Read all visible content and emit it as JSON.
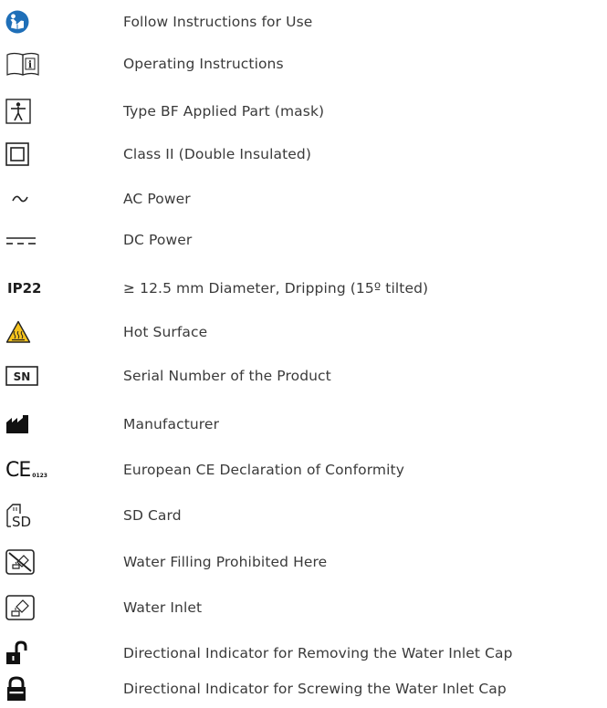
{
  "symbols": [
    {
      "icon": "follow-instructions-icon",
      "description": "Follow Instructions for Use"
    },
    {
      "icon": "operating-instructions-icon",
      "description": "Operating Instructions"
    },
    {
      "icon": "type-bf-applied-part-icon",
      "description": "Type BF Applied Part (mask)"
    },
    {
      "icon": "class-ii-icon",
      "description": "Class II (Double Insulated)"
    },
    {
      "icon": "ac-power-icon",
      "description": "AC Power"
    },
    {
      "icon": "dc-power-icon",
      "description": "DC Power"
    },
    {
      "icon": "ip22-label",
      "label": "IP22",
      "description": "≥ 12.5 mm Diameter, Dripping (15º tilted)"
    },
    {
      "icon": "hot-surface-icon",
      "description": "Hot Surface"
    },
    {
      "icon": "serial-number-icon",
      "label": "SN",
      "description": "Serial Number of the Product"
    },
    {
      "icon": "manufacturer-icon",
      "description": "Manufacturer"
    },
    {
      "icon": "ce-mark-icon",
      "label": "CE",
      "sub_label": "0123",
      "description": "European CE Declaration of Conformity"
    },
    {
      "icon": "sd-card-icon",
      "label": "SD",
      "description": "SD Card"
    },
    {
      "icon": "water-filling-prohibited-icon",
      "description": "Water Filling Prohibited Here"
    },
    {
      "icon": "water-inlet-icon",
      "description": "Water Inlet"
    },
    {
      "icon": "unlock-icon",
      "description": "Directional Indicator for Removing the Water Inlet Cap"
    },
    {
      "icon": "lock-icon",
      "description": "Directional Indicator for Screwing the Water Inlet Cap"
    }
  ],
  "colors": {
    "blue": "#1f6fb8",
    "warning_yellow": "#f6c31c",
    "text": "#3a3a3a",
    "ink": "#111111"
  }
}
